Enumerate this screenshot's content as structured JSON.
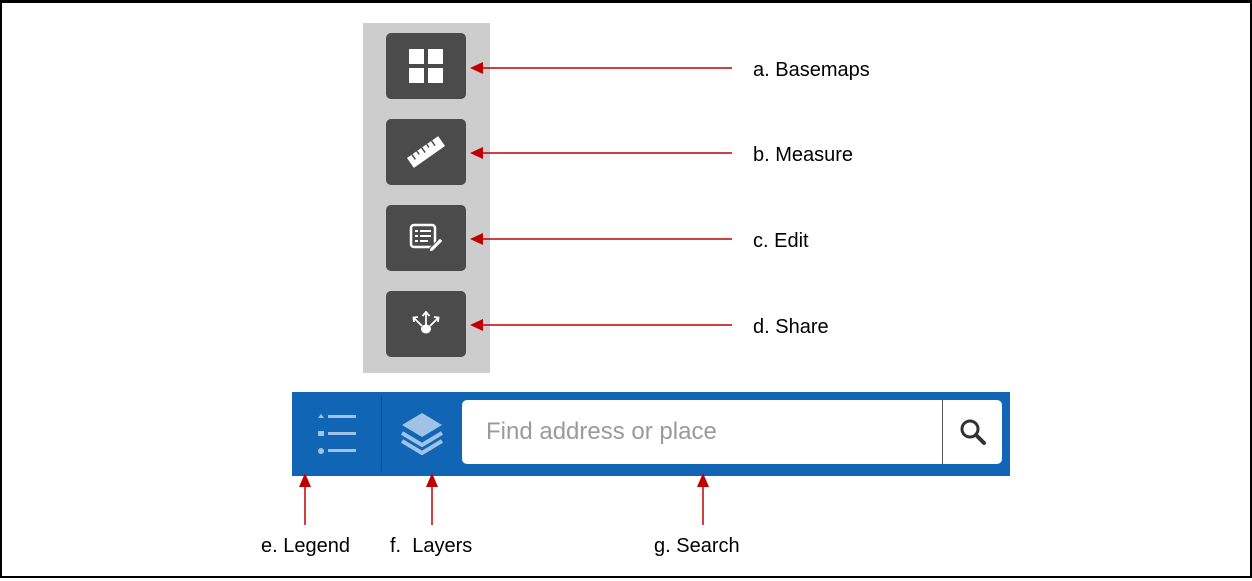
{
  "tools": [
    {
      "icon": "basemaps-grid-icon",
      "callout": "a. Basemaps"
    },
    {
      "icon": "ruler-icon",
      "callout": "b. Measure"
    },
    {
      "icon": "edit-list-icon",
      "callout": "c. Edit"
    },
    {
      "icon": "share-icon",
      "callout": "d. Share"
    }
  ],
  "toolbar": {
    "legend_icon": "legend-list-icon",
    "layers_icon": "layers-stack-icon",
    "search": {
      "placeholder": "Find address or place",
      "icon": "magnifier-icon"
    }
  },
  "callouts": {
    "legend": "e. Legend",
    "layers": "f.  Layers",
    "search": "g. Search"
  },
  "colors": {
    "annotation_red": "#c00000",
    "toolbar_blue": "#1066b4",
    "tool_button": "#4b4b4b",
    "tool_panel": "#cdcdcd"
  }
}
